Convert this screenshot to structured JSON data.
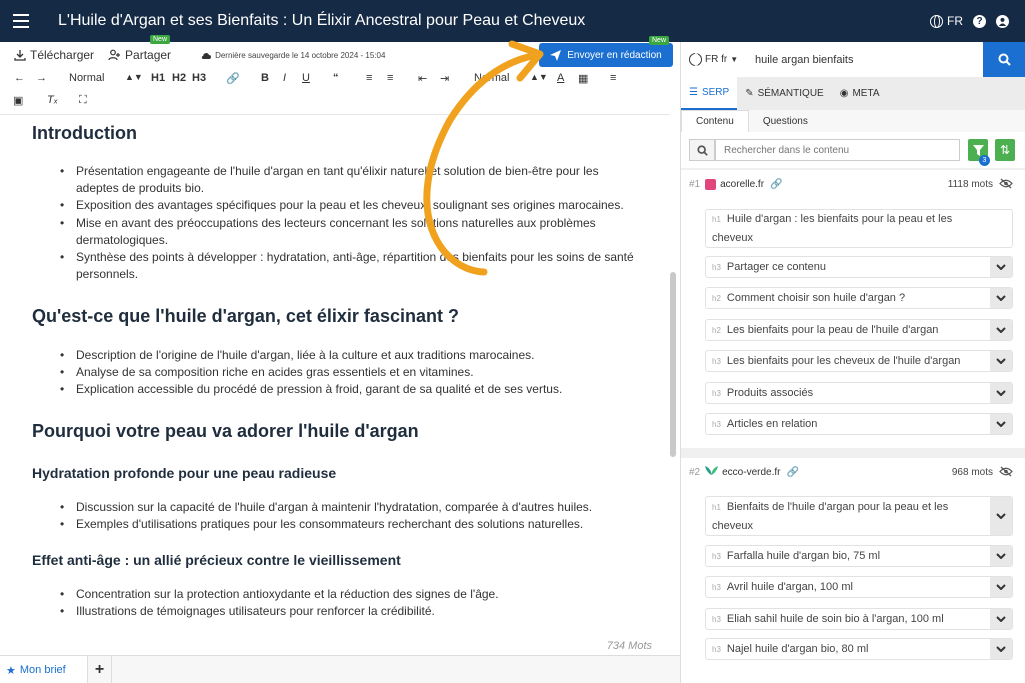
{
  "header": {
    "title": "L'Huile d'Argan et ses Bienfaits : Un Élixir Ancestral pour Peau et Cheveux",
    "lang": "FR",
    "icons": [
      "menu-icon",
      "globe-icon",
      "help-icon",
      "user-icon"
    ]
  },
  "toolbar": {
    "download": "Télécharger",
    "share": "Partager",
    "new_badge": "New",
    "autosave": "Dernière sauvegarde le 14 octobre 2024 - 15:04",
    "send": "Envoyer en rédaction",
    "style_select": "Normal",
    "h1": "H1",
    "h2": "H2",
    "h3": "H3",
    "bold": "B",
    "italic": "I",
    "underline": "U",
    "style_select2": "Normal"
  },
  "document": {
    "sections": [
      {
        "title": "Introduction",
        "items": [
          "Présentation engageante de l'huile d'argan en tant qu'élixir naturel et solution de bien-être pour les adeptes de produits bio.",
          "Exposition des avantages spécifiques pour la peau et les cheveux, soulignant ses origines marocaines.",
          "Mise en avant des préoccupations des lecteurs concernant les solutions naturelles aux problèmes dermatologiques.",
          "Synthèse des points à développer : hydratation, anti-âge, répartition des bienfaits pour les soins de santé personnels."
        ]
      },
      {
        "title": "Qu'est-ce que l'huile d'argan, cet élixir fascinant ?",
        "items": [
          "Description de l'origine de l'huile d'argan, liée à la culture et aux traditions marocaines.",
          "Analyse de sa composition riche en acides gras essentiels et en vitamines.",
          "Explication accessible du procédé de pression à froid, garant de sa qualité et de ses vertus."
        ]
      },
      {
        "title": "Pourquoi votre peau va adorer l'huile d'argan",
        "subsections": [
          {
            "title": "Hydratation profonde pour une peau radieuse",
            "items": [
              "Discussion sur la capacité de l'huile d'argan à maintenir l'hydratation, comparée à d'autres huiles.",
              "Exemples d'utilisations pratiques pour les consommateurs recherchant des solutions naturelles."
            ]
          },
          {
            "title": "Effet anti-âge : un allié précieux contre le vieillissement",
            "items": [
              "Concentration sur la protection antioxydante et la réduction des signes de l'âge.",
              "Illustrations de témoignages utilisateurs pour renforcer la crédibilité."
            ]
          }
        ]
      }
    ],
    "word_count": "734 Mots"
  },
  "bottom": {
    "brief_tab": "Mon brief",
    "add_tab": "+"
  },
  "panel": {
    "lang_select": "FR fr",
    "query": "huile argan bienfaits",
    "tabs": [
      "SERP",
      "SÉMANTIQUE",
      "META"
    ],
    "subtabs": [
      "Contenu",
      "Questions"
    ],
    "filter_placeholder": "Rechercher dans le contenu",
    "filter_count": "3",
    "results": [
      {
        "rank": "#1",
        "domain": "acorelle.fr",
        "words": "1118 mots",
        "favicon_color": "#e0457b",
        "headings": [
          {
            "tag": "h1",
            "text": "Huile d'argan : les bienfaits pour la peau et les cheveux"
          },
          {
            "tag": "h3",
            "text": "Partager ce contenu"
          },
          {
            "tag": "h2",
            "text": "Comment choisir son huile d'argan ?"
          },
          {
            "tag": "h2",
            "text": "Les bienfaits pour la peau de l'huile d'argan"
          },
          {
            "tag": "h3",
            "text": "Les bienfaits pour les cheveux de l'huile d'argan"
          },
          {
            "tag": "h3",
            "text": "Produits associés"
          },
          {
            "tag": "h3",
            "text": "Articles en relation"
          }
        ]
      },
      {
        "rank": "#2",
        "domain": "ecco-verde.fr",
        "words": "968 mots",
        "favicon_color": "#2e9a8a",
        "headings": [
          {
            "tag": "h1",
            "text": "Bienfaits de l'huile d'argan pour la peau et les cheveux"
          },
          {
            "tag": "h3",
            "text": "Farfalla huile d'argan bio, 75 ml"
          },
          {
            "tag": "h3",
            "text": "Avril huile d'argan, 100 ml"
          },
          {
            "tag": "h3",
            "text": "Eliah sahil huile de soin bio à l'argan, 100 ml"
          },
          {
            "tag": "h3",
            "text": "Najel huile d'argan bio, 80 ml"
          }
        ]
      }
    ]
  },
  "colors": {
    "header_bg": "#152a45",
    "accent": "#1a6fd1",
    "green": "#4caf50",
    "arrow": "#f0a21e"
  }
}
